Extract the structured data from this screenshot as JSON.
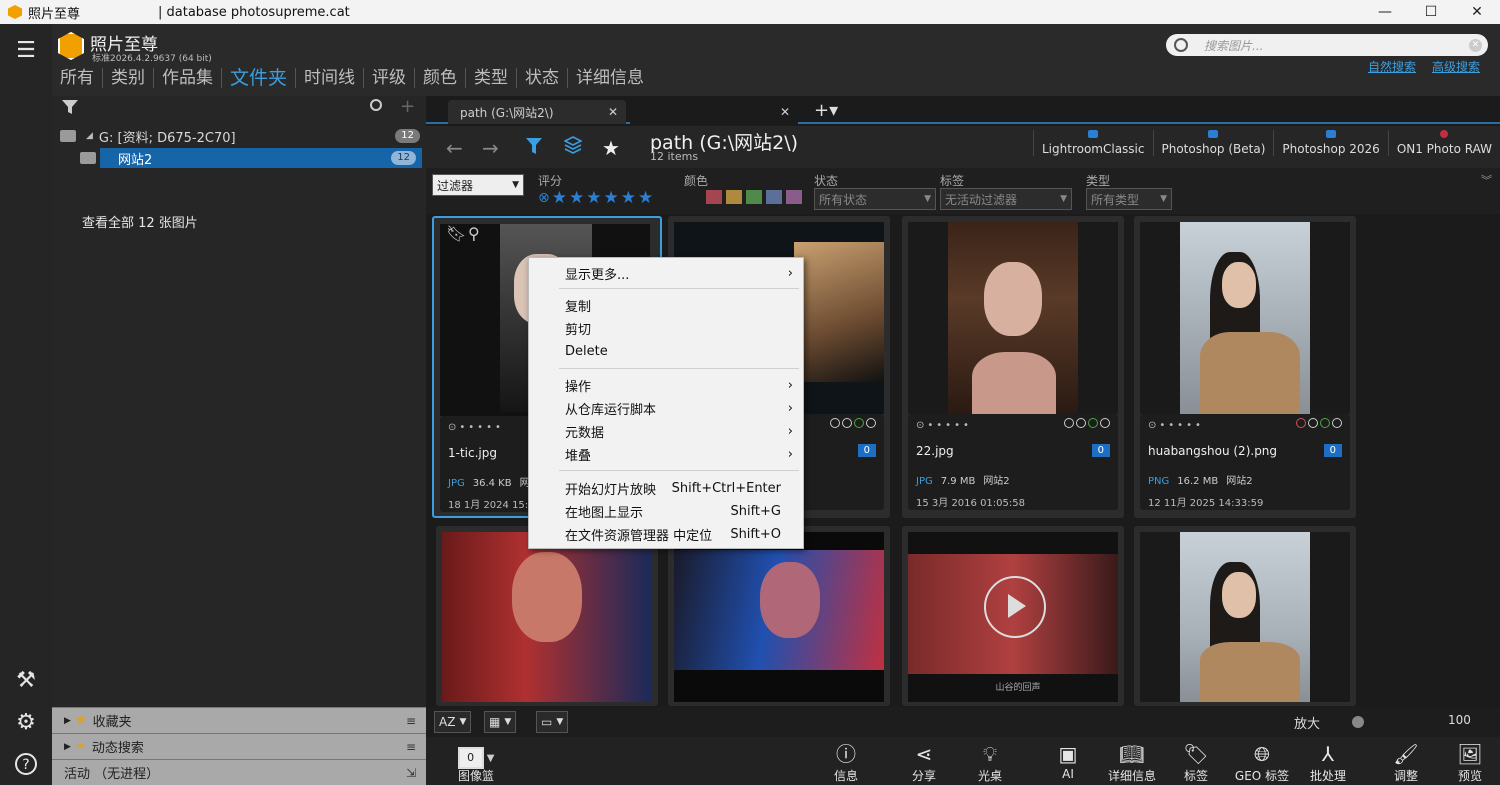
{
  "titlebar": {
    "app_name": "照片至尊",
    "database": "| database photosupreme.cat",
    "minimize": "—",
    "maximize": "☐",
    "close": "✕"
  },
  "header": {
    "brand": "照片至尊",
    "version": "标准2026.4.2.9637  (64 bit)",
    "nav_tabs": [
      "所有",
      "类别",
      "作品集",
      "文件夹",
      "时间线",
      "评级",
      "颜色",
      "类型",
      "状态",
      "详细信息"
    ],
    "active_tab": "文件夹",
    "search_placeholder": "搜索图片...",
    "search_links": [
      "自然搜索",
      "高级搜索"
    ]
  },
  "left_panel": {
    "tree": [
      {
        "label": "G:  [资料; D675-2C70]",
        "count": "12"
      },
      {
        "label": "网站2",
        "count": "12"
      }
    ],
    "view_all": "查看全部 12 张图片",
    "bottom": [
      {
        "label": "收藏夹",
        "icon": "star-icon"
      },
      {
        "label": "动态搜索",
        "icon": "dynamic-search-icon"
      },
      {
        "label": "活动 （无进程）",
        "icon": "activity-icon"
      }
    ]
  },
  "tabs": [
    {
      "label": "path (G:\\网站2\\)"
    },
    {
      "label": ""
    }
  ],
  "pathbar": {
    "title": "path  (G:\\网站2\\)",
    "subtitle": "12 items",
    "apps": [
      "LightroomClassic",
      "Photoshop (Beta)",
      "Photoshop 2026",
      "ON1 Photo RAW"
    ]
  },
  "filters": {
    "filter_select": "过滤器",
    "rating_label": "评分",
    "color_label": "颜色",
    "status_label": "状态",
    "status_value": "所有状态",
    "tags_label": "标签",
    "tags_value": "无活动过滤器",
    "type_label": "类型",
    "type_value": "所有类型",
    "swatches": [
      "#a4454f",
      "#b08a3c",
      "#4f8a4a",
      "#5c6e9a",
      "#8a5c8a"
    ]
  },
  "cards": [
    {
      "name": "1-tic.jpg",
      "type": "JPG",
      "size": "36.4 KB",
      "folder": "网",
      "date": "18 1月 2024 15:5",
      "badge": "0"
    },
    {
      "name": "",
      "type": "",
      "size": "",
      "folder": "",
      "date": "",
      "badge": "0"
    },
    {
      "name": "22.jpg",
      "type": "JPG",
      "size": "7.9 MB",
      "folder": "网站2",
      "date": "15 3月 2016 01:05:58",
      "badge": "0"
    },
    {
      "name": "huabangshou (2).png",
      "type": "PNG",
      "size": "16.2 MB",
      "folder": "网站2",
      "date": "12 11月 2025 14:33:59",
      "badge": "0"
    }
  ],
  "video_caption": "山谷的回声",
  "context_menu": {
    "items": [
      {
        "label": "显示更多...",
        "shortcut": "",
        "sub": true
      },
      {
        "label": "复制",
        "shortcut": "",
        "sub": false
      },
      {
        "label": "剪切",
        "shortcut": "",
        "sub": false
      },
      {
        "label": "Delete",
        "shortcut": "",
        "sub": false
      },
      {
        "label": "操作",
        "shortcut": "",
        "sub": true
      },
      {
        "label": "从仓库运行脚本",
        "shortcut": "",
        "sub": true
      },
      {
        "label": "元数据",
        "shortcut": "",
        "sub": true
      },
      {
        "label": "堆叠",
        "shortcut": "",
        "sub": true
      },
      {
        "label": "开始幻灯片放映",
        "shortcut": "Shift+Ctrl+Enter",
        "sub": false
      },
      {
        "label": "在地图上显示",
        "shortcut": "Shift+G",
        "sub": false
      },
      {
        "label": "在文件资源管理器 中定位",
        "shortcut": "Shift+O",
        "sub": false
      }
    ]
  },
  "statusbar": {
    "sort": "AZ",
    "zoom_label": "放大",
    "zoom_value": "100"
  },
  "actions": [
    {
      "label": "图像篮",
      "icon": "basket-icon",
      "count": "0"
    },
    {
      "label": "信息",
      "icon": "info-icon"
    },
    {
      "label": "分享",
      "icon": "share-icon"
    },
    {
      "label": "光桌",
      "icon": "lightbulb-icon"
    },
    {
      "label": "AI",
      "icon": "ai-icon"
    },
    {
      "label": "详细信息",
      "icon": "book-icon"
    },
    {
      "label": "标签",
      "icon": "tag-icon"
    },
    {
      "label": "GEO 标签",
      "icon": "globe-icon"
    },
    {
      "label": "批处理",
      "icon": "batch-icon"
    },
    {
      "label": "调整",
      "icon": "brush-icon"
    },
    {
      "label": "预览",
      "icon": "preview-icon"
    }
  ]
}
